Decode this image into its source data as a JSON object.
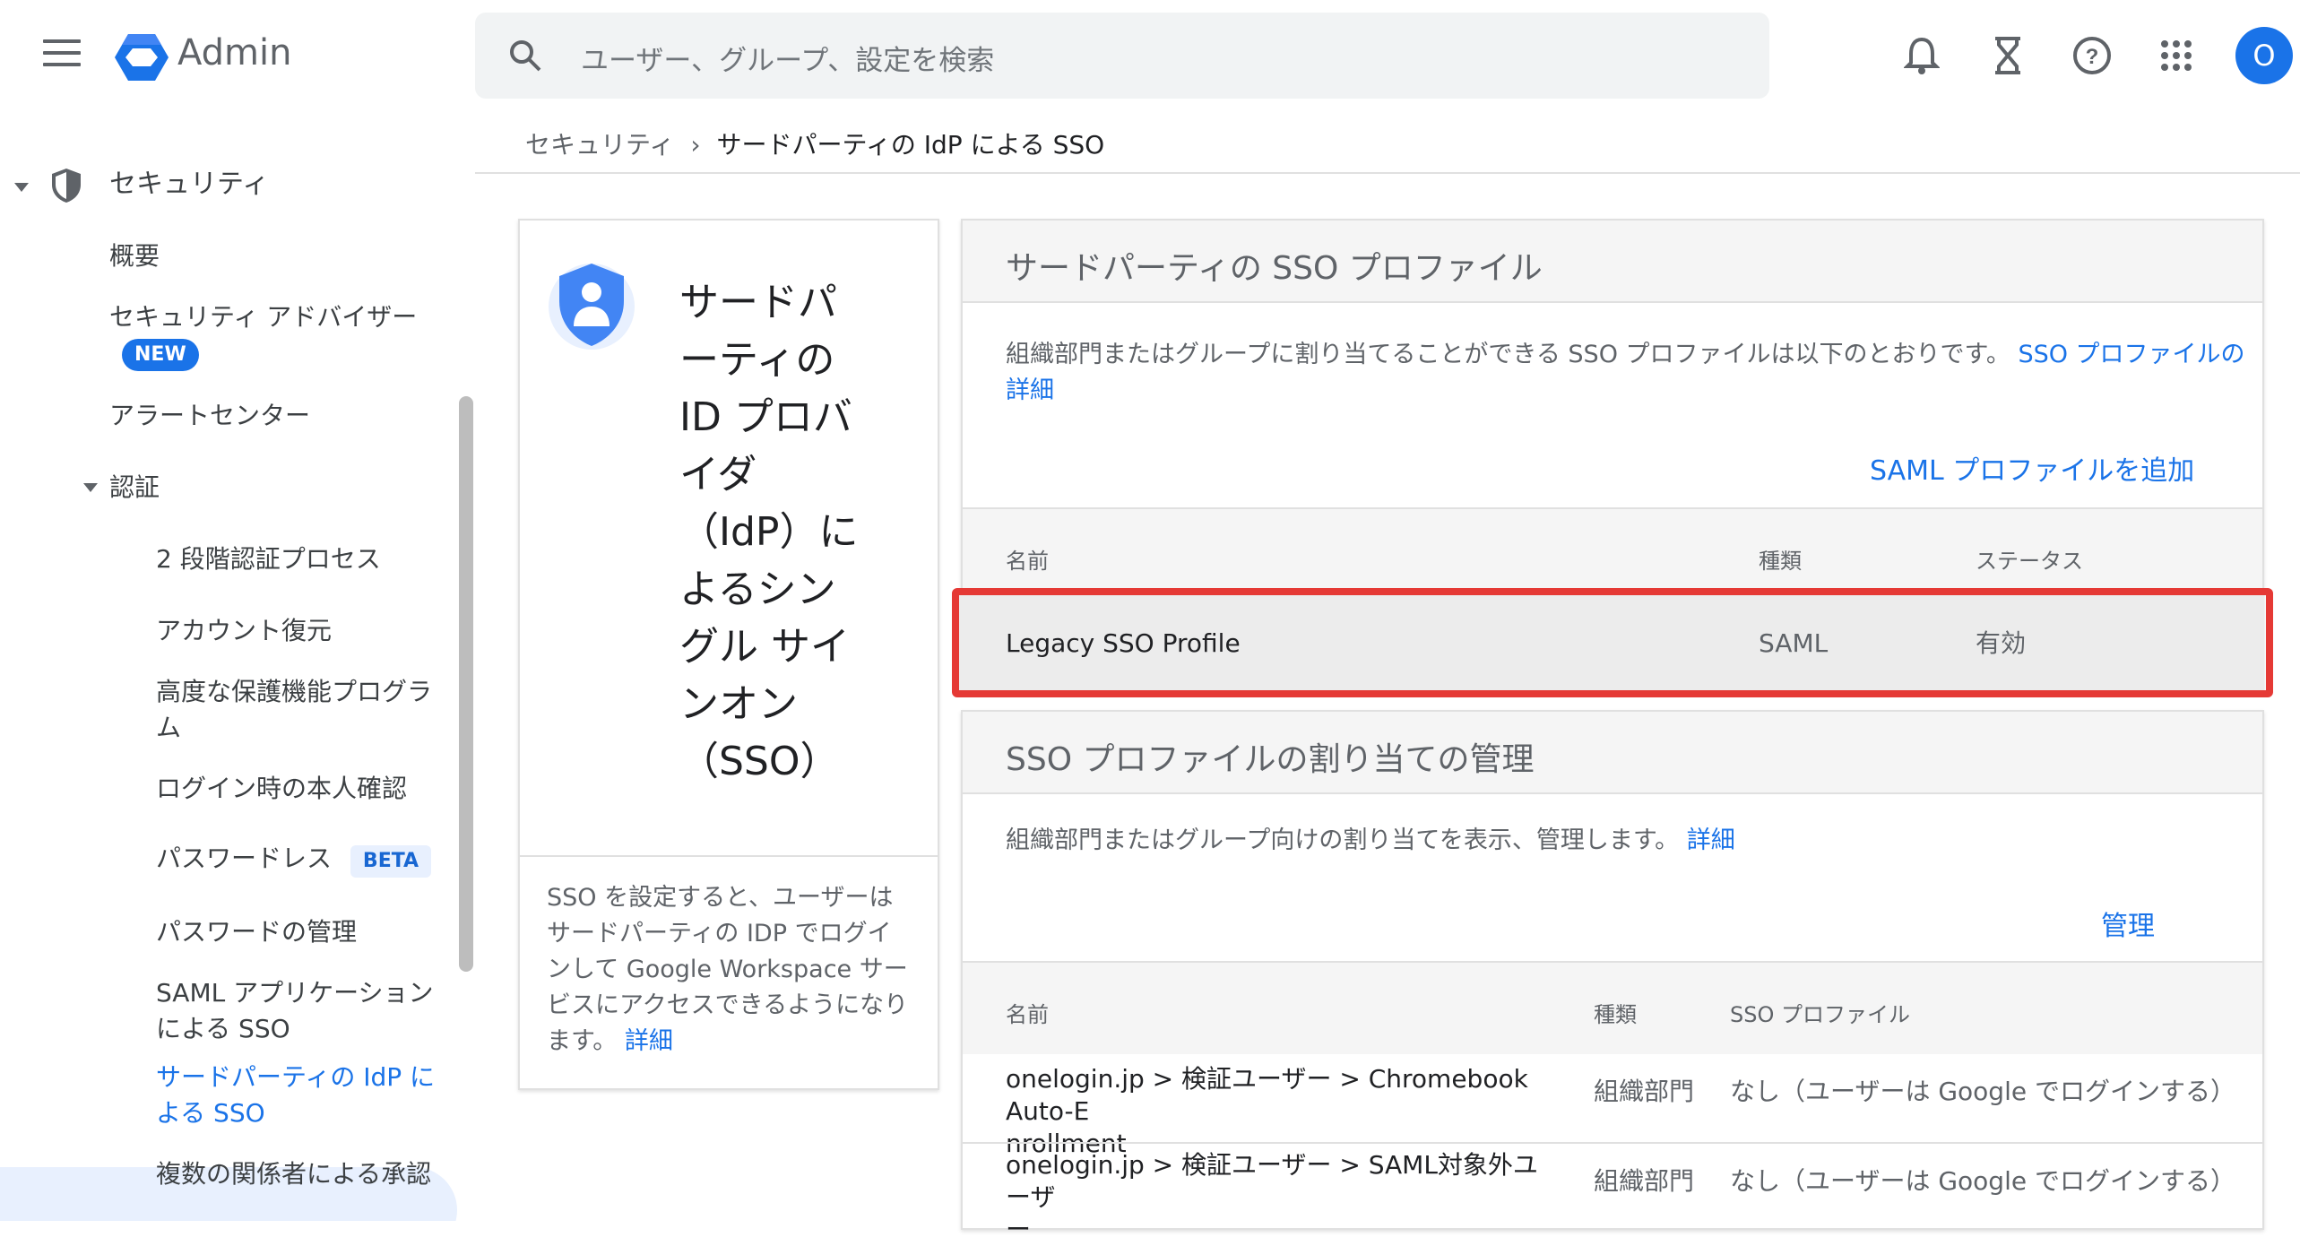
{
  "header": {
    "app_name": "Admin",
    "search_placeholder": "ユーザー、グループ、設定を検索",
    "avatar_letter": "O"
  },
  "breadcrumb": {
    "parent": "セキュリティ",
    "separator": "›",
    "current": "サードパーティの IdP による SSO"
  },
  "sidebar": {
    "section": "セキュリティ",
    "items": {
      "overview": "概要",
      "advisor": "セキュリティ アドバイザー",
      "advisor_badge": "NEW",
      "alert_center": "アラートセンター",
      "auth": "認証",
      "two_step": "2 段階認証プロセス",
      "account_recovery": "アカウント復元",
      "advanced_protection_1": "高度な保護機能プログラ",
      "advanced_protection_2": "ム",
      "login_challenge": "ログイン時の本人確認",
      "passwordless": "パスワードレス",
      "passwordless_badge": "BETA",
      "password_mgmt": "パスワードの管理",
      "saml_apps_1": "SAML アプリケーション",
      "saml_apps_2": "による SSO",
      "third_party_1": "サードパーティの IdP に",
      "third_party_2": "よる SSO",
      "multi_party": "複数の関係者による承認"
    }
  },
  "info_card": {
    "title_lines": [
      "サードパ",
      "ーティの",
      "ID プロバ",
      "イダ",
      "（IdP）に",
      "よるシン",
      "グル サイ",
      "ンオン",
      "（SSO）"
    ],
    "description": "SSO を設定すると、ユーザーはサードパーティの IDP でログインして Google Workspace サービスにアクセスできるようになります。",
    "link": "詳細"
  },
  "sso_profiles": {
    "heading": "サードパーティの SSO プロファイル",
    "description": "組織部門またはグループに割り当てることができる SSO プロファイルは以下のとおりです。",
    "link": "SSO プロファイルの詳細",
    "add_action": "SAML プロファイルを追加",
    "columns": [
      "名前",
      "種類",
      "ステータス"
    ],
    "rows": [
      {
        "name": "Legacy SSO Profile",
        "type": "SAML",
        "status": "有効"
      }
    ]
  },
  "assignments": {
    "heading": "SSO プロファイルの割り当ての管理",
    "description": "組織部門またはグループ向けの割り当てを表示、管理します。",
    "link": "詳細",
    "manage_action": "管理",
    "columns": [
      "名前",
      "種類",
      "SSO プロファイル"
    ],
    "rows": [
      {
        "name_1": "onelogin.jp > 検証ユーザー > Chromebook Auto-E",
        "name_2": "nrollment",
        "type": "組織部門",
        "profile": "なし（ユーザーは Google でログインする）"
      },
      {
        "name_1": "onelogin.jp > 検証ユーザー > SAML対象外ユーザ",
        "name_2": "ー",
        "type": "組織部門",
        "profile": "なし（ユーザーは Google でログインする）"
      }
    ]
  },
  "colors": {
    "accent": "#1a73e8",
    "highlight_border": "#e53935",
    "selected_bg": "#e8f0fe"
  }
}
